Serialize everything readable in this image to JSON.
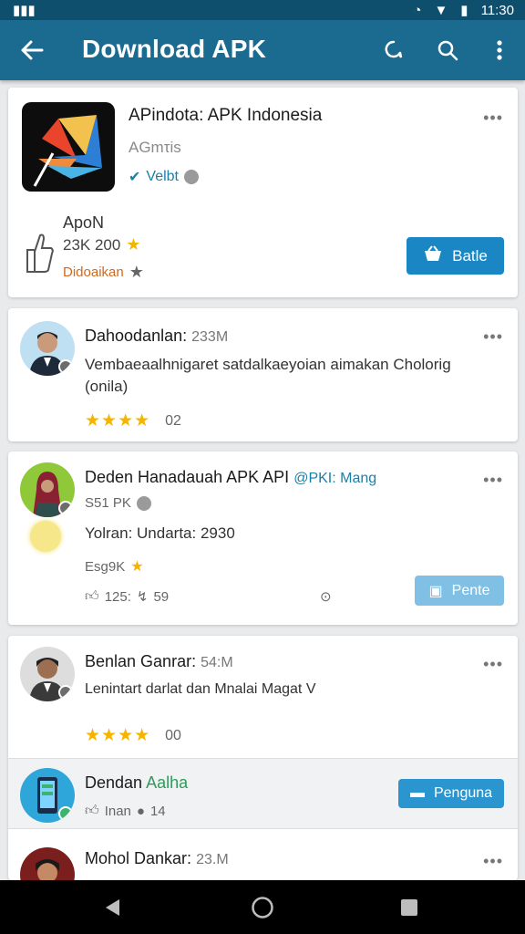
{
  "status_bar": {
    "left_icon": "signal-icon",
    "time": "11:30"
  },
  "app_bar": {
    "title": "Download APK"
  },
  "main_card": {
    "title": "APindota: APK Indonesia",
    "subtitle": "AGmτis",
    "verified_label": "Velbt",
    "apon_label": "ApoN",
    "apon_count": "23K 200",
    "download_label": "Didoaikan",
    "button_label": "Batle"
  },
  "reviews": [
    {
      "name": "Dahoodanlan:",
      "meta": "233M",
      "text": "Vembaeaalhnigaret satdalkaeyoian aimakan Cholorig (onila)",
      "stars": "★★★★",
      "count": "02"
    },
    {
      "name": "Deden Hanadauah APK API",
      "tag": "@PKI: Mang",
      "sub_meta": "S51 PK",
      "text": "Yolran: Undarta: 2930",
      "rating_label": "Esg9K",
      "likes": "125:",
      "likes2": "59",
      "button_label": "Pente"
    },
    {
      "name": "Benlan Ganrar:",
      "meta": "54:M",
      "text": "Lenintart darlat dan Mnalai Magat V",
      "stars": "★★★★",
      "count": "00"
    },
    {
      "name": "Dendan",
      "tag": "Aalha",
      "meta_label": "Inan",
      "meta_count": "14",
      "button_label": "Penguna"
    },
    {
      "name": "Mohol Dankar:",
      "meta": "23.M"
    }
  ],
  "colors": {
    "app_bar": "#1b6b91",
    "status_bar": "#0f4f6e",
    "accent_button": "#1a86c4",
    "star": "#f4b400"
  }
}
